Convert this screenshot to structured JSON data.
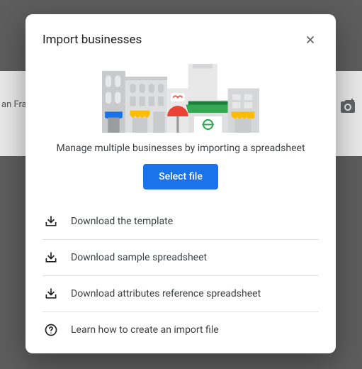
{
  "background": {
    "partial_text": "an Fra"
  },
  "dialog": {
    "title": "Import businesses",
    "subtitle": "Manage multiple businesses by importing a spreadsheet",
    "select_button": "Select file",
    "links": [
      {
        "label": "Download the template"
      },
      {
        "label": "Download sample spreadsheet"
      },
      {
        "label": "Download attributes reference spreadsheet"
      },
      {
        "label": "Learn how to create an import file"
      }
    ]
  }
}
